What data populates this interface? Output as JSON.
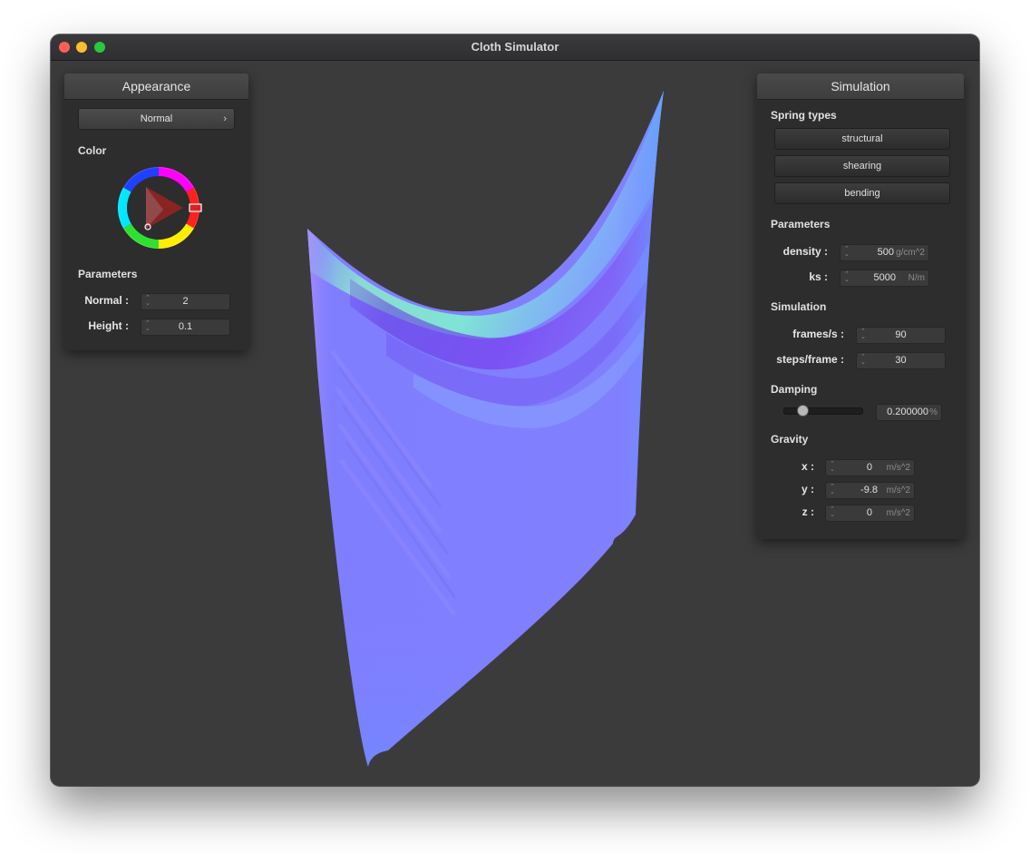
{
  "window": {
    "title": "Cloth Simulator"
  },
  "appearance": {
    "header": "Appearance",
    "shader": "Normal",
    "color_label": "Color",
    "params_label": "Parameters",
    "params": [
      {
        "label": "Normal :",
        "value": "2"
      },
      {
        "label": "Height :",
        "value": "0.1"
      }
    ],
    "selected_color": "#e02020"
  },
  "simulation": {
    "header": "Simulation",
    "spring_types_label": "Spring types",
    "spring_buttons": [
      "structural",
      "shearing",
      "bending"
    ],
    "parameters_label": "Parameters",
    "parameters": [
      {
        "label": "density :",
        "value": "500",
        "unit": "g/cm^2"
      },
      {
        "label": "ks :",
        "value": "5000",
        "unit": "N/m"
      }
    ],
    "sim_label": "Simulation",
    "sim_params": [
      {
        "label": "frames/s :",
        "value": "90"
      },
      {
        "label": "steps/frame :",
        "value": "30"
      }
    ],
    "damping_label": "Damping",
    "damping": {
      "value": "0.200000",
      "unit": "%",
      "slider_fraction": 0.2
    },
    "gravity_label": "Gravity",
    "gravity": [
      {
        "label": "x :",
        "value": "0",
        "unit": "m/s^2"
      },
      {
        "label": "y :",
        "value": "-9.8",
        "unit": "m/s^2"
      },
      {
        "label": "z :",
        "value": "0",
        "unit": "m/s^2"
      }
    ]
  },
  "colors": {
    "cloth_base": "#8080ff",
    "background": "#3b3b3b"
  }
}
